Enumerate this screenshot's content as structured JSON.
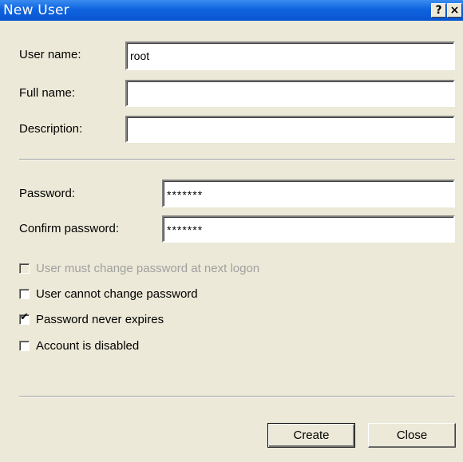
{
  "window": {
    "title": "New User",
    "help_glyph": "?",
    "close_glyph": "×"
  },
  "form": {
    "username_label": "User name:",
    "username_value": "root",
    "fullname_label": "Full name:",
    "fullname_value": "",
    "description_label": "Description:",
    "description_value": "",
    "password_label": "Password:",
    "password_value": "*******",
    "confirm_label": "Confirm password:",
    "confirm_value": "*******"
  },
  "options": [
    {
      "label": "User must change password at next logon",
      "checked": false,
      "enabled": false
    },
    {
      "label": "User cannot change password",
      "checked": false,
      "enabled": true
    },
    {
      "label": "Password never expires",
      "checked": true,
      "enabled": true
    },
    {
      "label": "Account is disabled",
      "checked": false,
      "enabled": true
    }
  ],
  "buttons": {
    "create_label": "Create",
    "close_label": "Close"
  },
  "colors": {
    "titlebar": "#0a55d0",
    "dialog_bg": "#ece9d8",
    "disabled_text": "#a0a0a0"
  }
}
